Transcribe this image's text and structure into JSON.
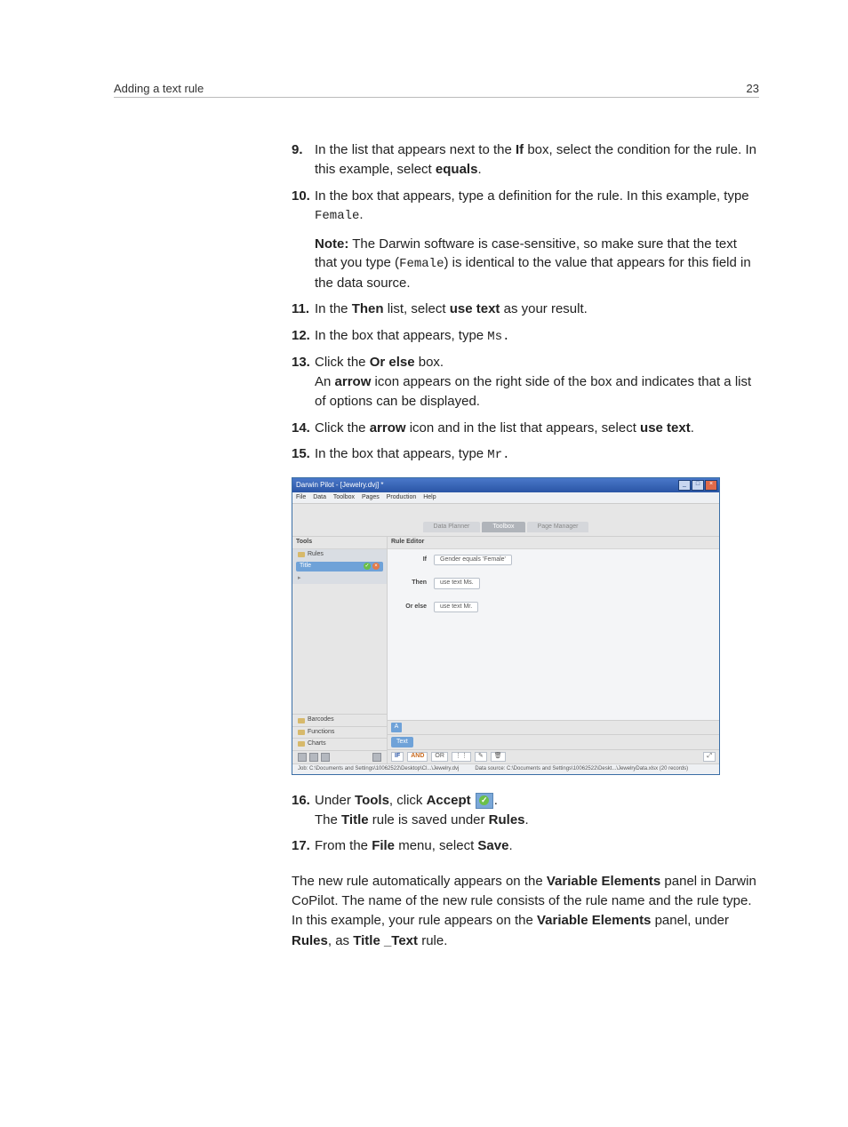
{
  "header": {
    "left": "Adding a text rule",
    "right": "23"
  },
  "steps": {
    "s9": {
      "num": "9.",
      "pre": "In the list that appears next to the ",
      "b1": "If",
      "mid": " box, select the condition for the rule. In this example, select ",
      "b2": "equals",
      "post": "."
    },
    "s10": {
      "num": "10.",
      "pre": "In the box that appears, type a definition for the rule. In this example, type ",
      "code": "Female",
      "post": "."
    },
    "note": {
      "label": "Note:",
      "pre": " The Darwin software is case-sensitive, so make sure that the text that you type (",
      "code": "Female",
      "post": ") is identical to the value that appears for this field in the data source."
    },
    "s11": {
      "num": "11.",
      "pre": "In the ",
      "b1": "Then",
      "mid": " list, select ",
      "b2": "use text",
      "post": " as your result."
    },
    "s12": {
      "num": "12.",
      "pre": "In the box that appears, type ",
      "code": "Ms.",
      "post": ""
    },
    "s13": {
      "num": "13.",
      "pre": "Click the ",
      "b1": "Or else",
      "mid": " box.",
      "line2a": "An ",
      "line2b": "arrow",
      "line2c": " icon appears on the right side of the box and indicates that a list of options can be displayed."
    },
    "s14": {
      "num": "14.",
      "pre": "Click the ",
      "b1": "arrow",
      "mid": " icon and in the list that appears, select ",
      "b2": "use text",
      "post": "."
    },
    "s15": {
      "num": "15.",
      "pre": "In the box that appears, type ",
      "code": "Mr.",
      "post": ""
    },
    "s16": {
      "num": "16.",
      "pre": "Under ",
      "b1": "Tools",
      "mid": ", click ",
      "b2": "Accept",
      "post": ".",
      "line2a": "The ",
      "line2b": "Title",
      "line2c": " rule is saved under ",
      "line2d": "Rules",
      "line2e": "."
    },
    "s17": {
      "num": "17.",
      "pre": "From the ",
      "b1": "File",
      "mid": " menu, select ",
      "b2": "Save",
      "post": "."
    }
  },
  "screenshot": {
    "title": "Darwin Pilot - [Jewelry.dvj] *",
    "menus": [
      "File",
      "Data",
      "Toolbox",
      "Pages",
      "Production",
      "Help"
    ],
    "tabs": {
      "t1": "Data Planner",
      "t2": "Toolbox",
      "t3": "Page Manager"
    },
    "tools": {
      "header": "Tools",
      "rules": "Rules",
      "title_item": "Title",
      "barcodes": "Barcodes",
      "functions": "Functions",
      "charts": "Charts"
    },
    "editor": {
      "header": "Rule Editor",
      "if_label": "If",
      "if_val": "Gender  equals  'Female'",
      "then_label": "Then",
      "then_val": "use text  Ms.",
      "orelse_label": "Or else",
      "orelse_val": "use text  Mr."
    },
    "bottom": {
      "text_btn": "Text",
      "if": "IF",
      "and": "AND",
      "or": "OR"
    },
    "a_icon": "A",
    "status": {
      "job": "Job: C:\\Documents and Settings\\10062522\\Desktop\\Cl...\\Jewelry.dvj",
      "ds": "Data source: C:\\Documents and Settings\\10062522\\Deskt...\\JewelryData.xlsx (20 records)"
    }
  },
  "closing": {
    "p1a": "The new rule automatically appears on the ",
    "p1b": "Variable Elements",
    "p1c": " panel in Darwin CoPilot. The name of the new rule consists of the rule name and the rule type. In this example, your rule appears on the ",
    "p1d": "Variable Elements",
    "p1e": " panel, under ",
    "p1f": "Rules",
    "p1g": ", as ",
    "p1h": "Title _Text",
    "p1i": " rule."
  }
}
